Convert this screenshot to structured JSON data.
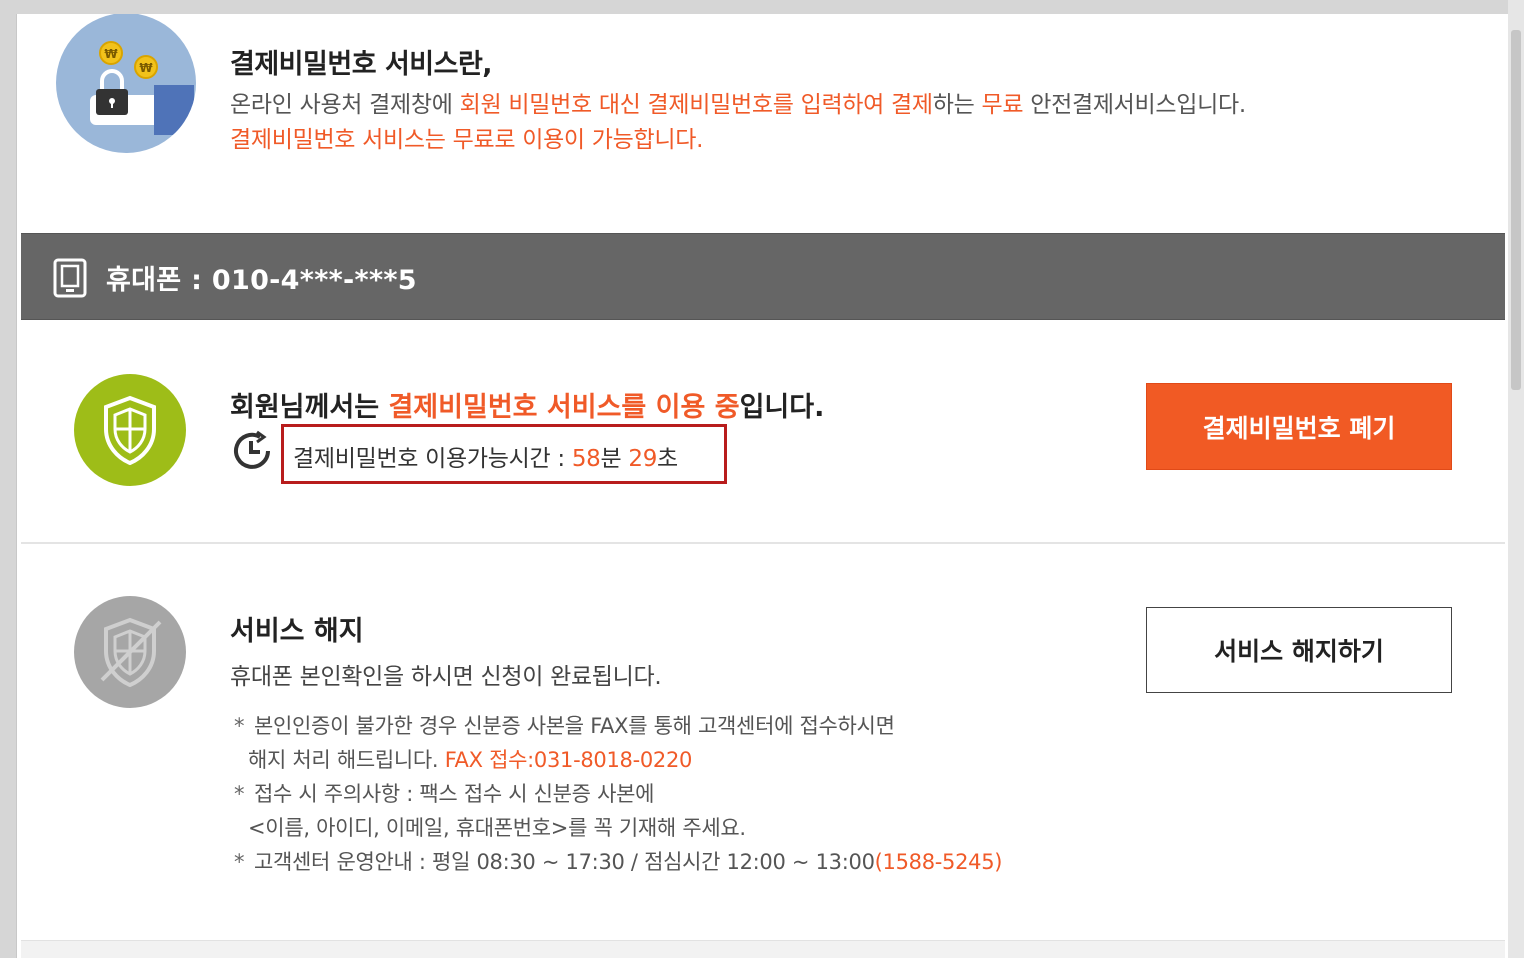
{
  "intro": {
    "title": "결제비밀번호 서비스란,",
    "line1": {
      "part1": "온라인 사용처 결제창에 ",
      "part2": "회원 비밀번호 대신 결제비밀번호를 입력하여 결제",
      "part3": "하는 ",
      "part4": "무료",
      "part5": " 안전결제서비스입니다."
    },
    "line2": "결제비밀번호 서비스는 무료로 이용이 가능합니다."
  },
  "phone": {
    "label": "휴대폰 : 010-4***-***5"
  },
  "status": {
    "title_part1": "회원님께서는 ",
    "title_part2": "결제비밀번호 서비스를 이용 중",
    "title_part3": "입니다.",
    "timer_label": "결제비밀번호 이용가능시간 : ",
    "minutes": "58",
    "minutes_unit": "분 ",
    "seconds": "29",
    "seconds_unit": "초",
    "discard_button": "결제비밀번호 폐기"
  },
  "cancel": {
    "title": "서비스 해지",
    "description": "휴대폰 본인확인을 하시면 신청이 완료됩니다.",
    "note_star": "*",
    "note1_line1": "본인인증이 불가한 경우 신분증 사본을 FAX를 통해 고객센터에 접수하시면",
    "note1_line2": "해지 처리 해드립니다. ",
    "note1_fax": "FAX 접수:031-8018-0220",
    "note2_line1": "접수 시 주의사항 : 팩스 접수 시 신분증 사본에",
    "note2_line2": "<이름, 아이디, 이메일, 휴대폰번호>를 꼭 기재해 주세요.",
    "note3_text": "고객센터 운영안내 : 평일 08:30 ~ 17:30 / 점심시간 12:00 ~ 13:00",
    "note3_phone": "(1588-5245)",
    "cancel_button": "서비스 해지하기"
  },
  "icons": {
    "intro": "coin-lock-hand-icon",
    "phone": "smartphone-icon",
    "status": "shield-icon",
    "clock": "clock-icon",
    "cancel": "shield-disabled-icon"
  },
  "colors": {
    "accent": "#f05a28",
    "button_orange": "#f15a24",
    "status_green": "#9ebd18",
    "disabled_gray": "#a6a6a6",
    "phone_bar": "#666666",
    "highlight_box": "#b81c1c"
  }
}
